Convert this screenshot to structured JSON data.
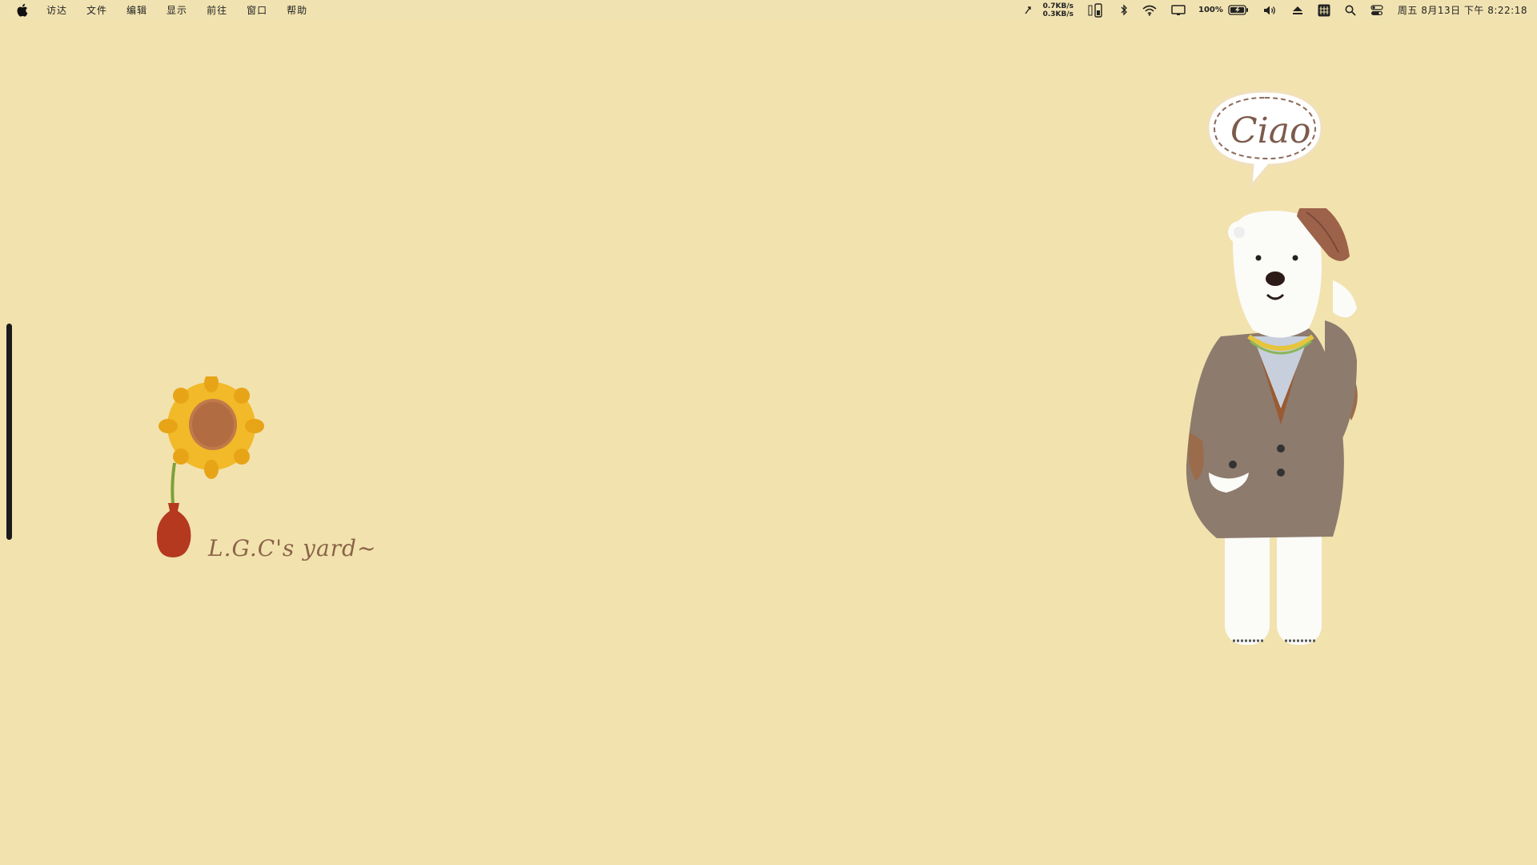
{
  "menubar": {
    "apple_icon": "apple-logo-icon",
    "items": [
      "访达",
      "文件",
      "编辑",
      "显示",
      "前往",
      "窗口",
      "帮助"
    ],
    "status": {
      "net_up": "0.7KB/s",
      "net_down": "0.3KB/s",
      "battery_percent": "100%",
      "clock": "周五 8月13日 下午 8:22:18"
    },
    "icons": [
      "cursor-icon",
      "phone-battery-icon",
      "bluetooth-icon",
      "wifi-icon",
      "display-icon",
      "battery-charging-icon",
      "volume-icon",
      "eject-icon",
      "input-method-icon",
      "search-icon",
      "control-center-icon"
    ]
  },
  "desktop": {
    "wallpaper_text": "L.G.C's yard~",
    "speech_bubble_text": "Ciao",
    "background_color": "#f2e2ae"
  }
}
